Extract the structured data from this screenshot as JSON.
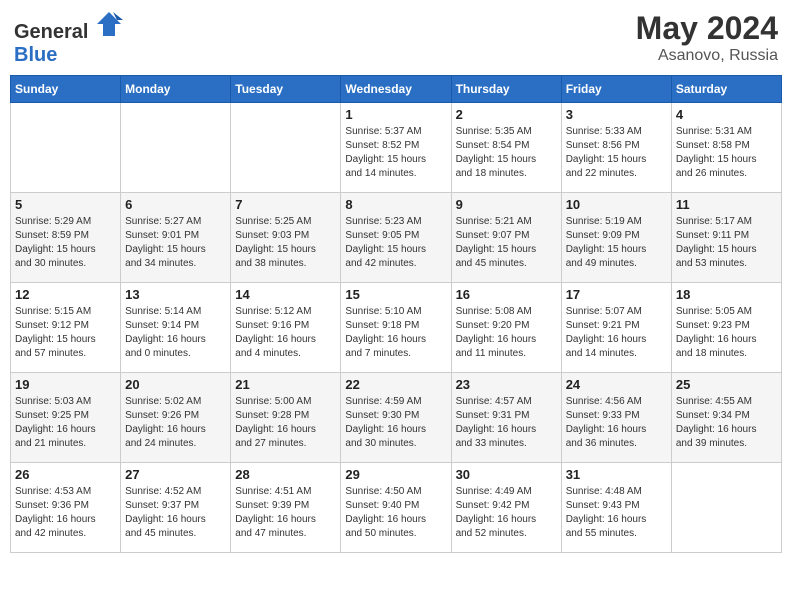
{
  "header": {
    "logo_general": "General",
    "logo_blue": "Blue",
    "title": "May 2024",
    "location": "Asanovo, Russia"
  },
  "weekdays": [
    "Sunday",
    "Monday",
    "Tuesday",
    "Wednesday",
    "Thursday",
    "Friday",
    "Saturday"
  ],
  "weeks": [
    [
      {
        "day": "",
        "info": ""
      },
      {
        "day": "",
        "info": ""
      },
      {
        "day": "",
        "info": ""
      },
      {
        "day": "1",
        "info": "Sunrise: 5:37 AM\nSunset: 8:52 PM\nDaylight: 15 hours\nand 14 minutes."
      },
      {
        "day": "2",
        "info": "Sunrise: 5:35 AM\nSunset: 8:54 PM\nDaylight: 15 hours\nand 18 minutes."
      },
      {
        "day": "3",
        "info": "Sunrise: 5:33 AM\nSunset: 8:56 PM\nDaylight: 15 hours\nand 22 minutes."
      },
      {
        "day": "4",
        "info": "Sunrise: 5:31 AM\nSunset: 8:58 PM\nDaylight: 15 hours\nand 26 minutes."
      }
    ],
    [
      {
        "day": "5",
        "info": "Sunrise: 5:29 AM\nSunset: 8:59 PM\nDaylight: 15 hours\nand 30 minutes."
      },
      {
        "day": "6",
        "info": "Sunrise: 5:27 AM\nSunset: 9:01 PM\nDaylight: 15 hours\nand 34 minutes."
      },
      {
        "day": "7",
        "info": "Sunrise: 5:25 AM\nSunset: 9:03 PM\nDaylight: 15 hours\nand 38 minutes."
      },
      {
        "day": "8",
        "info": "Sunrise: 5:23 AM\nSunset: 9:05 PM\nDaylight: 15 hours\nand 42 minutes."
      },
      {
        "day": "9",
        "info": "Sunrise: 5:21 AM\nSunset: 9:07 PM\nDaylight: 15 hours\nand 45 minutes."
      },
      {
        "day": "10",
        "info": "Sunrise: 5:19 AM\nSunset: 9:09 PM\nDaylight: 15 hours\nand 49 minutes."
      },
      {
        "day": "11",
        "info": "Sunrise: 5:17 AM\nSunset: 9:11 PM\nDaylight: 15 hours\nand 53 minutes."
      }
    ],
    [
      {
        "day": "12",
        "info": "Sunrise: 5:15 AM\nSunset: 9:12 PM\nDaylight: 15 hours\nand 57 minutes."
      },
      {
        "day": "13",
        "info": "Sunrise: 5:14 AM\nSunset: 9:14 PM\nDaylight: 16 hours\nand 0 minutes."
      },
      {
        "day": "14",
        "info": "Sunrise: 5:12 AM\nSunset: 9:16 PM\nDaylight: 16 hours\nand 4 minutes."
      },
      {
        "day": "15",
        "info": "Sunrise: 5:10 AM\nSunset: 9:18 PM\nDaylight: 16 hours\nand 7 minutes."
      },
      {
        "day": "16",
        "info": "Sunrise: 5:08 AM\nSunset: 9:20 PM\nDaylight: 16 hours\nand 11 minutes."
      },
      {
        "day": "17",
        "info": "Sunrise: 5:07 AM\nSunset: 9:21 PM\nDaylight: 16 hours\nand 14 minutes."
      },
      {
        "day": "18",
        "info": "Sunrise: 5:05 AM\nSunset: 9:23 PM\nDaylight: 16 hours\nand 18 minutes."
      }
    ],
    [
      {
        "day": "19",
        "info": "Sunrise: 5:03 AM\nSunset: 9:25 PM\nDaylight: 16 hours\nand 21 minutes."
      },
      {
        "day": "20",
        "info": "Sunrise: 5:02 AM\nSunset: 9:26 PM\nDaylight: 16 hours\nand 24 minutes."
      },
      {
        "day": "21",
        "info": "Sunrise: 5:00 AM\nSunset: 9:28 PM\nDaylight: 16 hours\nand 27 minutes."
      },
      {
        "day": "22",
        "info": "Sunrise: 4:59 AM\nSunset: 9:30 PM\nDaylight: 16 hours\nand 30 minutes."
      },
      {
        "day": "23",
        "info": "Sunrise: 4:57 AM\nSunset: 9:31 PM\nDaylight: 16 hours\nand 33 minutes."
      },
      {
        "day": "24",
        "info": "Sunrise: 4:56 AM\nSunset: 9:33 PM\nDaylight: 16 hours\nand 36 minutes."
      },
      {
        "day": "25",
        "info": "Sunrise: 4:55 AM\nSunset: 9:34 PM\nDaylight: 16 hours\nand 39 minutes."
      }
    ],
    [
      {
        "day": "26",
        "info": "Sunrise: 4:53 AM\nSunset: 9:36 PM\nDaylight: 16 hours\nand 42 minutes."
      },
      {
        "day": "27",
        "info": "Sunrise: 4:52 AM\nSunset: 9:37 PM\nDaylight: 16 hours\nand 45 minutes."
      },
      {
        "day": "28",
        "info": "Sunrise: 4:51 AM\nSunset: 9:39 PM\nDaylight: 16 hours\nand 47 minutes."
      },
      {
        "day": "29",
        "info": "Sunrise: 4:50 AM\nSunset: 9:40 PM\nDaylight: 16 hours\nand 50 minutes."
      },
      {
        "day": "30",
        "info": "Sunrise: 4:49 AM\nSunset: 9:42 PM\nDaylight: 16 hours\nand 52 minutes."
      },
      {
        "day": "31",
        "info": "Sunrise: 4:48 AM\nSunset: 9:43 PM\nDaylight: 16 hours\nand 55 minutes."
      },
      {
        "day": "",
        "info": ""
      }
    ]
  ]
}
